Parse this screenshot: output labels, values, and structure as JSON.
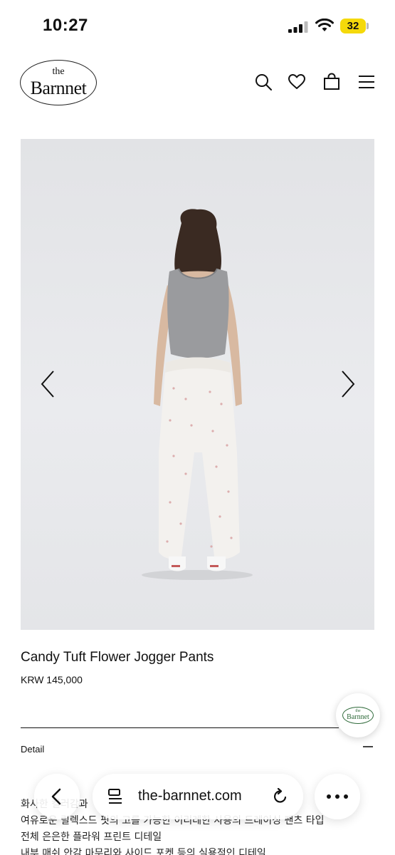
{
  "status_bar": {
    "time": "10:27",
    "battery": "32"
  },
  "header": {
    "logo_the": "the",
    "logo_name": "Barnnet",
    "icons": [
      "search-icon",
      "heart-icon",
      "bag-icon",
      "menu-icon"
    ]
  },
  "product": {
    "name": "Candy Tuft Flower Jogger Pants",
    "price": "KRW 145,000"
  },
  "float_badge": {
    "the": "the",
    "name": "Barnnet"
  },
  "detail": {
    "label": "Detail",
    "lines": [
      "화사한 컬러감과",
      "여유로운 릴렉스드 핏의 고를 가능한 이리레한 사용의 드레이싱 팬츠 타입",
      "전체 은은한 플라워 프린트 디테일",
      "내부 매쉬 안감 마무리와 사이드 포켓 등의 실용적인 디테일"
    ]
  },
  "browser": {
    "url": "the-barnnet.com"
  },
  "colors": {
    "battery": "#f5d90a",
    "image_bg": "#e6e7ea",
    "top": "#9a9b9e",
    "pants": "#f3f1ee"
  }
}
